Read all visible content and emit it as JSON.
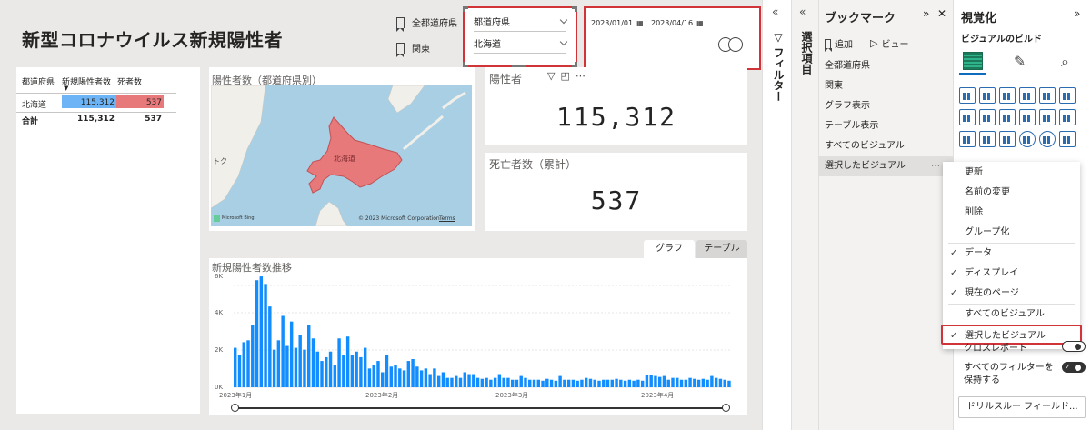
{
  "report": {
    "title": "新型コロナウイルス新規陽性者",
    "bookmark_buttons": [
      "全都道府県",
      "関東"
    ],
    "slicer": {
      "label": "都道府県",
      "value": "北海道"
    },
    "dates": {
      "start": "2023/01/01",
      "end": "2023/04/16"
    },
    "table": {
      "headers": [
        "都道府県",
        "新規陽性者数",
        "死者数"
      ],
      "rows": [
        {
          "pref": "北海道",
          "cases": "115,312",
          "deaths": "537"
        }
      ],
      "total": {
        "label": "合計",
        "cases": "115,312",
        "deaths": "537"
      }
    },
    "map": {
      "title": "陽性者数（都道府県別）",
      "region_label": "北海道",
      "side_label": "トク",
      "credit_left": "Microsoft Bing",
      "credit_right": "© 2023 Microsoft Corporation",
      "terms": "Terms"
    },
    "kpi1": {
      "label": "陽性者",
      "value": "115,312"
    },
    "kpi2": {
      "label": "死亡者数（累計）",
      "value": "537"
    },
    "tabs": [
      "グラフ",
      "テーブル"
    ],
    "colors": {
      "bar": "#118dff",
      "map_fill": "#e8797b",
      "highlight_border": "#d13438"
    }
  },
  "chart_data": {
    "type": "bar",
    "title": "新規陽性者数推移",
    "yticks": [
      "6K",
      "4K",
      "2K",
      "0K"
    ],
    "ylim": [
      0,
      6000
    ],
    "xticks": [
      "2023年1月",
      "2023年2月",
      "2023年3月",
      "2023年4月"
    ],
    "values": [
      2100,
      1700,
      2400,
      2500,
      3300,
      5700,
      5900,
      5500,
      4300,
      2000,
      2500,
      3800,
      2200,
      3500,
      2100,
      2800,
      2000,
      3300,
      2600,
      1900,
      1400,
      1600,
      1900,
      1200,
      2600,
      1700,
      2700,
      1700,
      1900,
      1600,
      2100,
      1000,
      1200,
      1400,
      800,
      1700,
      1100,
      1200,
      1000,
      900,
      1400,
      1500,
      1100,
      900,
      1000,
      700,
      1000,
      600,
      800,
      500,
      500,
      600,
      500,
      800,
      700,
      700,
      500,
      450,
      500,
      400,
      500,
      700,
      500,
      500,
      400,
      400,
      600,
      500,
      400,
      400,
      400,
      350,
      450,
      400,
      350,
      600,
      400,
      400,
      400,
      350,
      400,
      500,
      450,
      400,
      350,
      400,
      400,
      400,
      450,
      400,
      350,
      400,
      350,
      400,
      350,
      650,
      650,
      600,
      550,
      600,
      400,
      500,
      500,
      400,
      400,
      500,
      450,
      400,
      450,
      400,
      600,
      500,
      450,
      400,
      350
    ]
  },
  "filter_pane": {
    "label": "フィルター"
  },
  "selection_pane": {
    "label": "選択項目"
  },
  "bookmark_pane": {
    "title": "ブックマーク",
    "add": "追加",
    "view": "ビュー",
    "items": [
      "全都道府県",
      "関東",
      "グラフ表示",
      "テーブル表示",
      "すべてのビジュアル",
      "選択したビジュアル"
    ]
  },
  "context_menu": {
    "items": [
      {
        "label": "更新",
        "checked": false
      },
      {
        "label": "名前の変更",
        "checked": false
      },
      {
        "label": "削除",
        "checked": false
      },
      {
        "label": "グループ化",
        "checked": false
      },
      {
        "label": "データ",
        "checked": true
      },
      {
        "label": "ディスプレイ",
        "checked": true
      },
      {
        "label": "現在のページ",
        "checked": true
      },
      {
        "label": "すべてのビジュアル",
        "checked": false
      },
      {
        "label": "選択したビジュアル",
        "checked": true
      }
    ]
  },
  "viz_pane": {
    "title": "視覚化",
    "subtitle": "ビジュアルのビルド",
    "cross_report": "クロスレポート",
    "keep_filters": "すべてのフィルターを保持する",
    "drill": "ドリルスルー フィールド..."
  }
}
